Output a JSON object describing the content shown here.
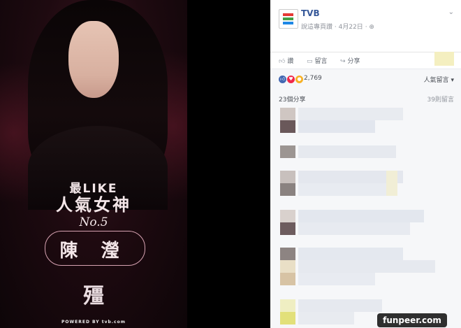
{
  "poster": {
    "line1": "最LIKE",
    "line2": "人氣女神",
    "rank": "No.5",
    "name": "陳 瀅",
    "logo_char": "殭",
    "powered_by": "POWERED BY tvb.com"
  },
  "post": {
    "page_name": "TVB",
    "subtitle": "說這專頁讚",
    "date": "4月22日",
    "actions": {
      "like": "讚",
      "comment": "留言",
      "share": "分享"
    },
    "reaction_count": "2,769",
    "sort_label": "人氣留言 ▾",
    "shares_label": "23個分享",
    "comments_label": "39則留言"
  },
  "watermark": "funpeer.com"
}
